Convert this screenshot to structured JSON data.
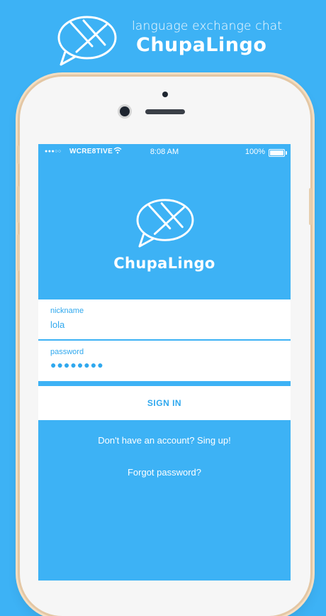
{
  "promo": {
    "tagline": "language exchange chat",
    "title": "ChupaLingo",
    "logo_icon": "envelope-speech-bubble-icon"
  },
  "colors": {
    "background": "#3DB2F5",
    "accent": "#2FA8EE",
    "phone_frame": "#E4C7A4"
  },
  "status_bar": {
    "signal": "●●●○○",
    "carrier": "WCRE8TIVE",
    "time": "8:08 AM",
    "battery": "100%",
    "battery_level": 1.0
  },
  "app": {
    "title": "ChupaLingo",
    "logo_icon": "envelope-speech-bubble-icon"
  },
  "form": {
    "nickname": {
      "label": "nickname",
      "value": "lola"
    },
    "password": {
      "label": "password",
      "value": "●●●●●●●●"
    },
    "sign_in_label": "SIGN IN"
  },
  "links": {
    "signup": "Don't have an account? Sing up!",
    "forgot": "Forgot password?"
  }
}
